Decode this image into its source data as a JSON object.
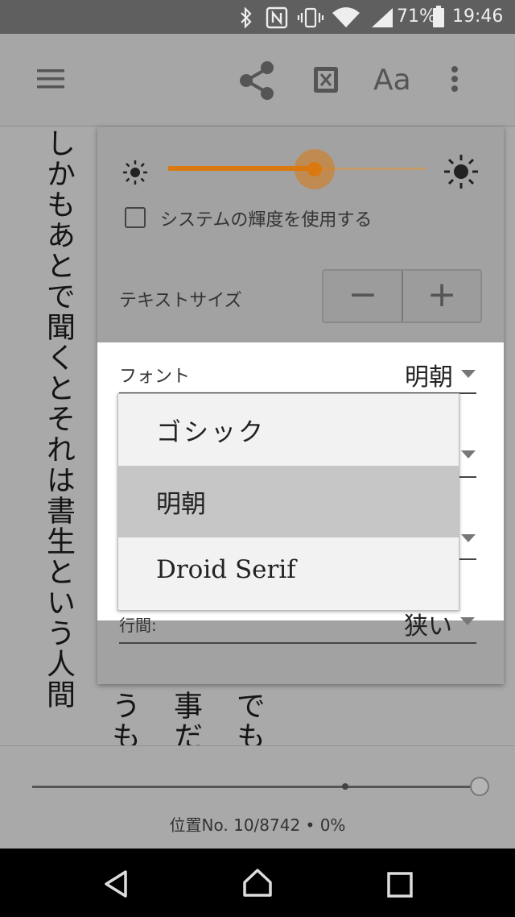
{
  "status_bar": {
    "battery": "71%",
    "time": "19:46"
  },
  "toolbar": {
    "menu_icon": "hamburger-icon",
    "share_icon": "share-icon",
    "dictionary_icon": "x-ray-icon",
    "font_icon_label": "Aa",
    "more_icon": "more-vert-icon"
  },
  "reader": {
    "columns": [
      "しかもあとで聞くとそれは書生という人間",
      "うも",
      "事だ",
      "でも"
    ]
  },
  "settings": {
    "system_brightness_label": "システムの輝度を使用する",
    "brightness": 0.57,
    "text_size_label": "テキストサイズ",
    "minus_label": "−",
    "plus_label": "+",
    "font_label": "フォント",
    "font_value": "明朝",
    "line_spacing_label": "行間:",
    "line_spacing_value": "狭い"
  },
  "dropdown": {
    "options": [
      "ゴシック",
      "明朝",
      "Droid Serif"
    ],
    "selected_index": 1
  },
  "progress": {
    "location_text": "位置No. 10/8742 • 0%",
    "fraction": 0.001
  },
  "colors": {
    "accent": "#d9790f",
    "panel": "#a2a2a2"
  }
}
